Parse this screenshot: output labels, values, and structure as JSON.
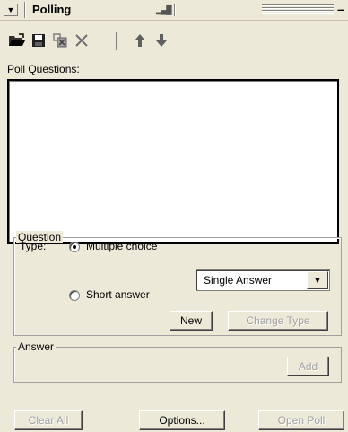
{
  "titlebar": {
    "title": "Polling",
    "collapse_glyph": "▼",
    "signal_glyph": "▂▄█",
    "close_glyph": "–"
  },
  "toolbar": {
    "icons": [
      "open-folder-icon",
      "save-icon",
      "clear-results-icon",
      "delete-icon",
      "move-up-icon",
      "move-down-icon"
    ]
  },
  "poll": {
    "questions_label": "Poll Questions:",
    "questions": []
  },
  "question": {
    "group_label": "Question",
    "type_label": "Type:",
    "option_multiple": "Multiple choice",
    "option_short": "Short answer",
    "selected": "Multiple choice",
    "answer_mode": "Single Answer",
    "new_button": "New",
    "change_type_button": "Change Type"
  },
  "answer": {
    "group_label": "Answer",
    "add_button": "Add"
  },
  "footer": {
    "clear_all": "Clear All",
    "options": "Options...",
    "open_poll": "Open Poll"
  }
}
